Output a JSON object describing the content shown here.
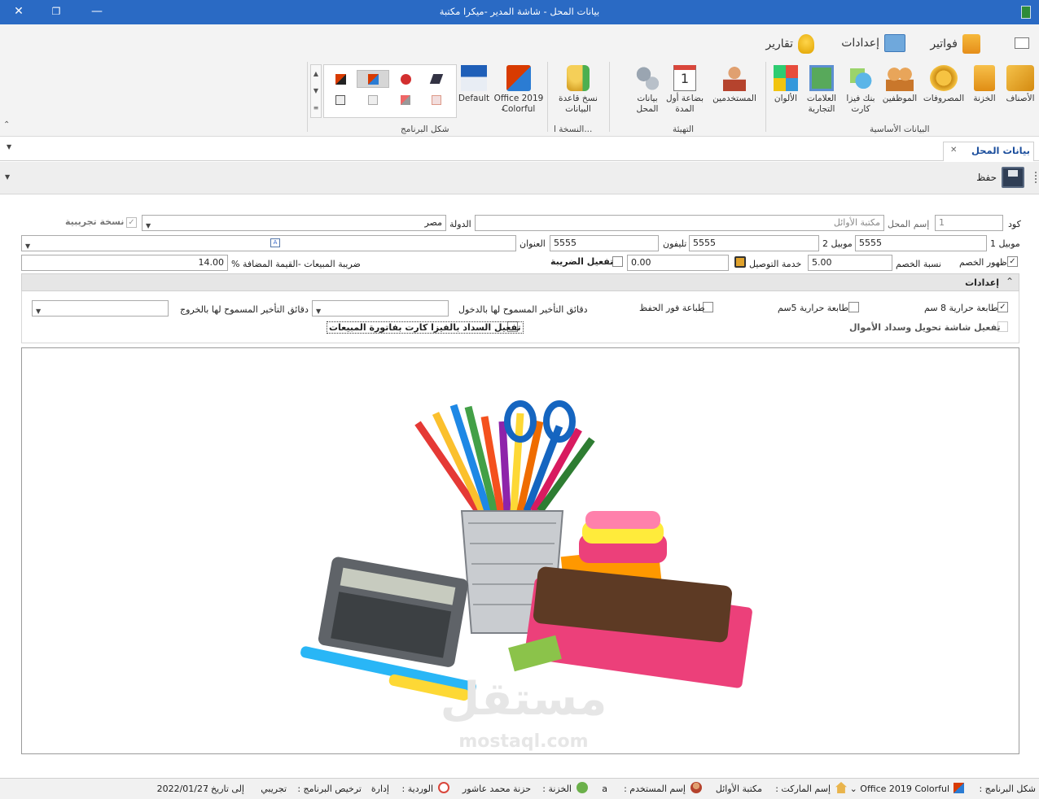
{
  "window": {
    "title": "بيانات المحل - شاشة المدير -ميكرا مكتبة",
    "close_glyph": "✕",
    "restore_glyph": "❐",
    "minimize_glyph": "—"
  },
  "ribbon": {
    "tabs": {
      "invoices": "فواتير",
      "settings": "إعدادات",
      "reports": "تقارير"
    },
    "groups": {
      "basic": {
        "label": "البيانات الأساسية",
        "items": [
          "الأصناف",
          "الخزنة",
          "المصروفات",
          "الموظفين",
          "بنك فيزا كارت",
          "العلامات التجارية",
          "الألوان"
        ]
      },
      "setup": {
        "label": "التهيئة",
        "items": [
          "المستخدمين",
          "بضاعة أول المدة",
          "بيانات المحل"
        ]
      },
      "backup": {
        "label": "النسخة ا...",
        "items": [
          "نسخ قاعدة البيانات"
        ]
      },
      "theme": {
        "label": "شكل البرنامج",
        "office_label": "Office 2019 Colorful",
        "default_label": "Default"
      }
    }
  },
  "doc_tab": {
    "label": "بيانات المحل",
    "close_glyph": "✕"
  },
  "toolbar": {
    "save_label": "حفظ"
  },
  "form": {
    "code_label": "كود",
    "code_value": "1",
    "shop_name_label": "إسم المحل",
    "shop_name_value": "مكتبة الأوائل",
    "country_label": "الدولة",
    "country_value": "مصر",
    "trial_label": "نسخة تجريبية",
    "mobile1_label": "موبيل 1",
    "mobile1_value": "5555",
    "mobile2_label": "موبيل 2",
    "mobile2_value": "5555",
    "phone_label": "تليفون",
    "phone_value": "5555",
    "address_label": "العنوان",
    "address_value": "",
    "show_discount_label": "ظهور الخصم",
    "discount_rate_label": "نسبة الخصم",
    "discount_rate_value": "5.00",
    "delivery_label": "خدمة التوصيل",
    "delivery_value": "0.00",
    "tax_enable_label": "تفعيل الضريبة",
    "vat_label": "ضريبة المبيعات -القيمة المضافة %",
    "vat_value": "14.00"
  },
  "settings_panel": {
    "header": "إعدادات",
    "printer8_label": "طابعة حرارية 8 سم",
    "printer5_label": "طابعة حرارية 5سم",
    "print_on_save_label": "طباعة فور الحفظ",
    "login_delay_label": "دقائق التأخير المسموح لها بالدخول",
    "exit_delay_label": "دقائق التأخير المسموح لها بالخروج",
    "transfer_screen_label": "تفعيل شاشة تحويل وسداد الأموال",
    "visa_payment_label": "تفعيل السداد بالفيزا كارت بفاتورة المبيعات"
  },
  "watermark": {
    "arabic": "مستقل",
    "latin": "mostaql.com"
  },
  "status_bar": {
    "theme_label": "شكل البرنامج :",
    "theme_value": "Office 2019 Colorful",
    "market_label": "إسم الماركت :",
    "market_value": "مكتبة الأوائل",
    "user_label": "إسم المستخدم :",
    "user_value": "a",
    "safe_label": "الخزنة :",
    "safe_value": "حزنة محمد عاشور",
    "shift_label": "الوردية :",
    "shift_value": "إدارة",
    "license_label": "ترخيص البرنامج :",
    "license_value": "تجريبي",
    "until_label": "إلى تاريخ :",
    "until_value": "2022/01/27"
  }
}
